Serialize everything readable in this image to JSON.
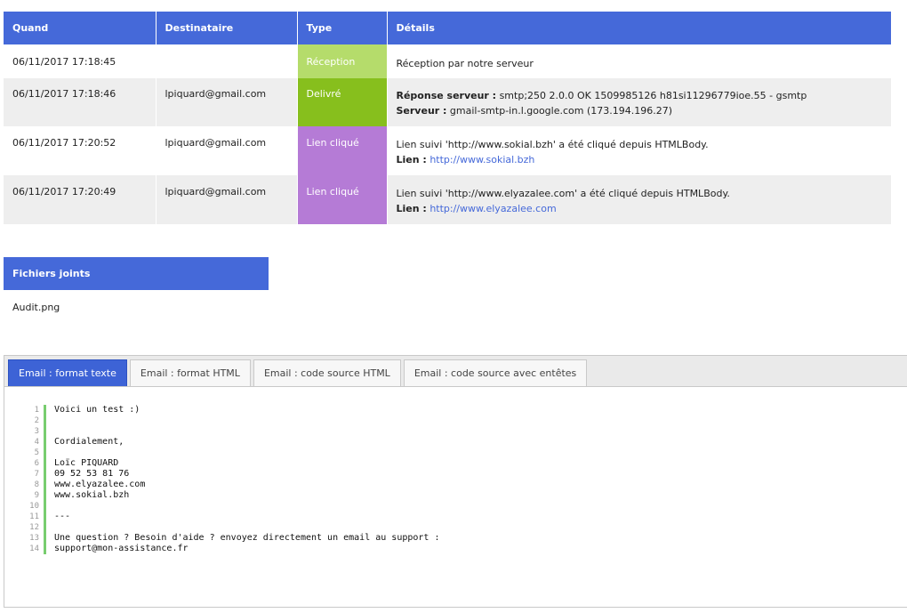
{
  "events_table": {
    "headers": [
      "Quand",
      "Destinataire",
      "Type",
      "Détails"
    ],
    "rows": [
      {
        "date": "06/11/2017 17:18:45",
        "recipient": "",
        "type": "Réception",
        "detail_line1": "Réception par notre serveur"
      },
      {
        "date": "06/11/2017 17:18:46",
        "recipient": "lpiquard@gmail.com",
        "type": "Delivré",
        "label1": "Réponse serveur :",
        "value1": " smtp;250 2.0.0 OK 1509985126 h81si11296779ioe.55 - gsmtp",
        "label2": "Serveur :",
        "value2": " gmail-smtp-in.l.google.com (173.194.196.27)"
      },
      {
        "date": "06/11/2017 17:20:52",
        "recipient": "lpiquard@gmail.com",
        "type": "Lien cliqué",
        "detail_line1": "Lien suivi 'http://www.sokial.bzh' a été cliqué depuis HTMLBody.",
        "label2": "Lien :",
        "link": "http://www.sokial.bzh"
      },
      {
        "date": "06/11/2017 17:20:49",
        "recipient": "lpiquard@gmail.com",
        "type": "Lien cliqué",
        "detail_line1": "Lien suivi 'http://www.elyazalee.com' a été cliqué depuis HTMLBody.",
        "label2": "Lien :",
        "link": "http://www.elyazalee.com"
      }
    ]
  },
  "type_colors": {
    "header": "#4569d9",
    "reception": "#b5dc6b",
    "delivre": "#87bf1d",
    "lien_clique": "#b57bd6"
  },
  "attachments": {
    "title": "Fichiers joints",
    "files": [
      "Audit.png"
    ]
  },
  "tabs": [
    {
      "label": "Email : format texte",
      "active": true
    },
    {
      "label": "Email : format HTML",
      "active": false
    },
    {
      "label": "Email : code source HTML",
      "active": false
    },
    {
      "label": "Email : code source avec entêtes",
      "active": false
    }
  ],
  "code_lines": [
    "Voici un test :)",
    "",
    "",
    "Cordialement,",
    "",
    "Loïc PIQUARD",
    "09 52 53 81 76",
    "www.elyazalee.com",
    "www.sokial.bzh",
    "",
    "---",
    "",
    "Une question ? Besoin d'aide ? envoyez directement un email au support :",
    "support@mon-assistance.fr"
  ],
  "line_numbers": [
    "1",
    "2",
    "3",
    "4",
    "5",
    "6",
    "7",
    "8",
    "9",
    "10",
    "11",
    "12",
    "13",
    "14"
  ]
}
